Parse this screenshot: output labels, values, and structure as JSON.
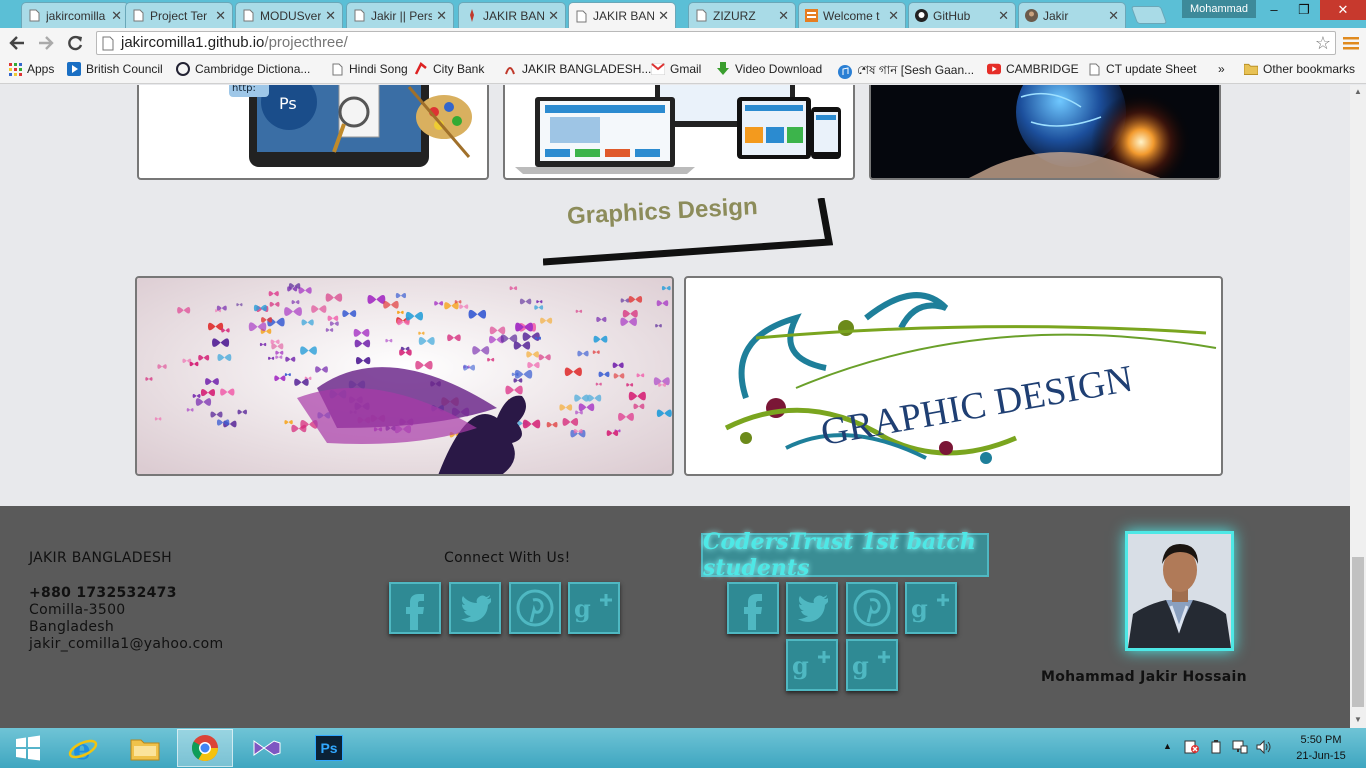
{
  "browser": {
    "tabs": [
      {
        "title": "jakircomilla",
        "icon": "document-icon"
      },
      {
        "title": "Project Ter",
        "icon": "document-icon"
      },
      {
        "title": "MODUSver",
        "icon": "document-icon"
      },
      {
        "title": "Jakir || Pers",
        "icon": "document-icon"
      },
      {
        "title": "JAKIR BAN",
        "icon": "jb-logo-icon"
      },
      {
        "title": "JAKIR BAN",
        "icon": "document-icon",
        "active": true
      },
      {
        "title": "ZIZURZ",
        "icon": "document-icon"
      },
      {
        "title": "Welcome t",
        "icon": "tile-icon"
      },
      {
        "title": "GitHub",
        "icon": "github-icon"
      },
      {
        "title": "Jakir",
        "icon": "avatar-icon"
      }
    ],
    "profile_name": "Mohammad",
    "url_host": "jakircomilla1.github.io",
    "url_path": "/projecthree/",
    "bookmarks": [
      {
        "label": "Apps",
        "icon": "apps-grid-icon"
      },
      {
        "label": "British Council",
        "icon": "play-icon"
      },
      {
        "label": "Cambridge Dictiona...",
        "icon": "cambridge-icon"
      },
      {
        "label": "Hindi Song",
        "icon": "document-icon"
      },
      {
        "label": "City Bank",
        "icon": "citybank-icon"
      },
      {
        "label": "JAKIR BANGLADESH...",
        "icon": "jb-logo-icon"
      },
      {
        "label": "Gmail",
        "icon": "gmail-icon"
      },
      {
        "label": "Video Download",
        "icon": "download-arrow-icon"
      },
      {
        "label": "শেষ গান [Sesh Gaan...",
        "icon": "music-icon"
      },
      {
        "label": "CAMBRIDGE",
        "icon": "youtube-icon"
      },
      {
        "label": "CT update Sheet",
        "icon": "document-icon"
      }
    ],
    "bookmarks_overflow": "»",
    "other_bookmarks": "Other bookmarks"
  },
  "page": {
    "section_heading": "Graphics Design",
    "footer": {
      "brand": "JAKIR BANGLADESH",
      "phone": "+880 1732532473",
      "city": "Comilla-3500",
      "country": "Bangladesh",
      "email": "jakir_comilla1@yahoo.com",
      "connect_title": "Connect With Us!",
      "coders_title": "CodersTrust 1st batch students",
      "person_name": "Mohammad Jakir Hossain"
    },
    "gd_banner_text": "GRAPHIC DESIGN"
  },
  "taskbar": {
    "time": "5:50 PM",
    "date": "21-Jun-15",
    "apps": [
      "start-icon",
      "internet-explorer-icon",
      "file-explorer-icon",
      "chrome-icon",
      "visual-studio-icon",
      "photoshop-icon"
    ]
  },
  "colors": {
    "accent_teal": "#4ee8e6",
    "footer_bg": "#5a5a5a",
    "heading_olive": "#8c8c5a"
  }
}
